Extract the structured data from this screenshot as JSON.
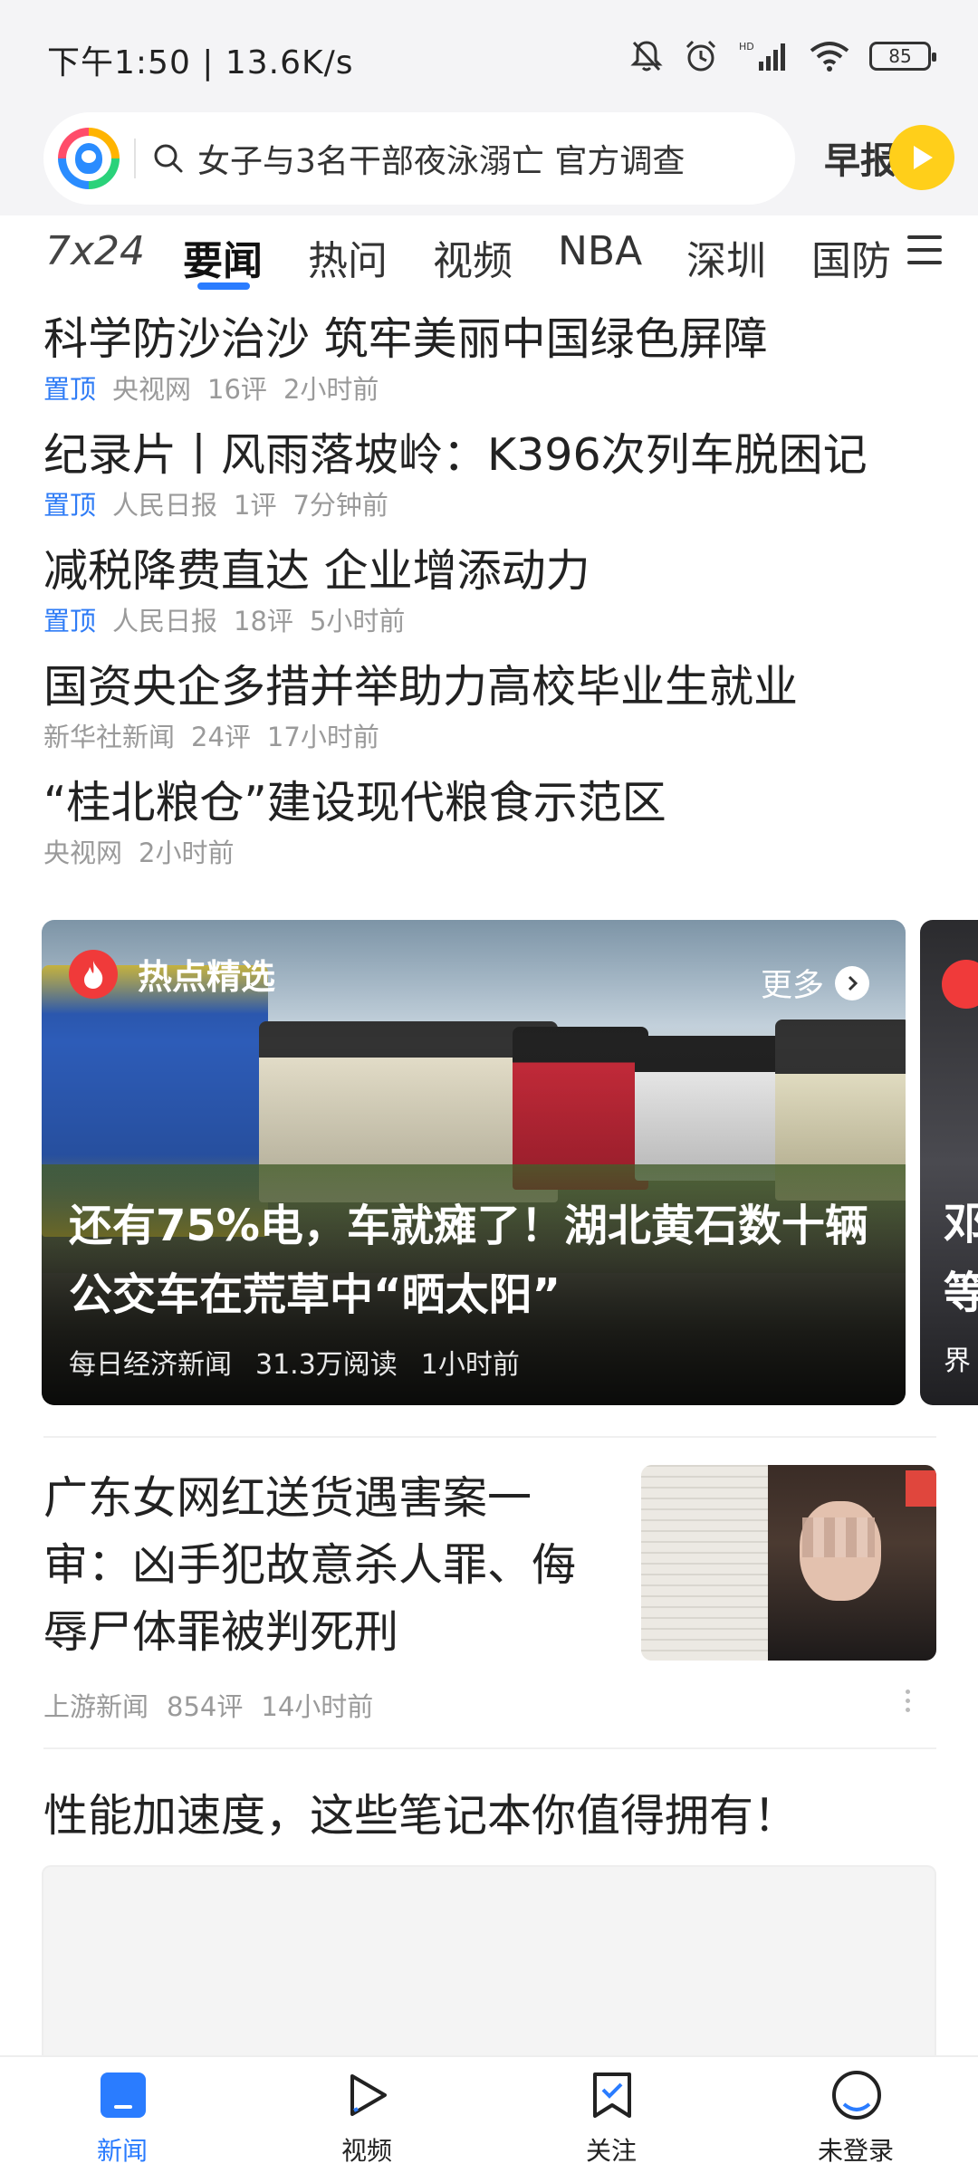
{
  "status_bar": {
    "time": "下午1:50 | 13.6K/s",
    "battery": "85",
    "icons": [
      "mute-icon",
      "alarm-icon",
      "hd-signal-icon",
      "wifi-icon",
      "battery-icon"
    ]
  },
  "header": {
    "search_text": "女子与3名干部夜泳溺亡 官方调查",
    "morning_label": "早报",
    "logo": "app-logo"
  },
  "tabs": [
    "7x24",
    "要闻",
    "热问",
    "视频",
    "NBA",
    "深圳",
    "国防"
  ],
  "active_tab": "要闻",
  "top_news": [
    {
      "title": "科学防沙治沙 筑牢美丽中国绿色屏障",
      "pin": "置顶",
      "source": "央视网",
      "comments": "16评",
      "time": "2小时前"
    },
    {
      "title": "纪录片丨风雨落坡岭：K396次列车脱困记",
      "pin": "置顶",
      "source": "人民日报",
      "comments": "1评",
      "time": "7分钟前"
    },
    {
      "title": "减税降费直达 企业增添动力",
      "pin": "置顶",
      "source": "人民日报",
      "comments": "18评",
      "time": "5小时前"
    },
    {
      "title": "国资央企多措并举助力高校毕业生就业",
      "pin": "",
      "source": "新华社新闻",
      "comments": "24评",
      "time": "17小时前"
    },
    {
      "title": "“桂北粮仓”建设现代粮食示范区",
      "pin": "",
      "source": "央视网",
      "comments": "",
      "time": "2小时前"
    }
  ],
  "hot": {
    "label": "热点精选",
    "more": "更多",
    "title": "还有75%电，车就瘫了！湖北黄石数十辆公交车在荒草中“晒太阳”",
    "source": "每日经济新闻",
    "reads": "31.3万阅读",
    "time": "1小时前",
    "peek_chars": [
      "邓",
      "等",
      "界"
    ]
  },
  "article": {
    "title": "广东女网红送货遇害案一审：凶手犯故意杀人罪、侮辱尸体罪被判死刑",
    "source": "上游新闻",
    "comments": "854评",
    "time": "14小时前"
  },
  "ad": {
    "title": "性能加速度，这些笔记本你值得拥有！"
  },
  "bottom_nav": [
    {
      "label": "新闻",
      "icon": "news-icon",
      "active": true
    },
    {
      "label": "视频",
      "icon": "video-play-icon",
      "active": false
    },
    {
      "label": "关注",
      "icon": "follow-bookmark-icon",
      "active": false
    },
    {
      "label": "未登录",
      "icon": "profile-icon",
      "active": false
    }
  ],
  "colors": {
    "accent": "#2a7cff",
    "pin": "#2f7cf6",
    "hot_fire": "#f03a3a",
    "morning_button": "#ffcf1a",
    "meta_gray": "#9a9a9a"
  }
}
